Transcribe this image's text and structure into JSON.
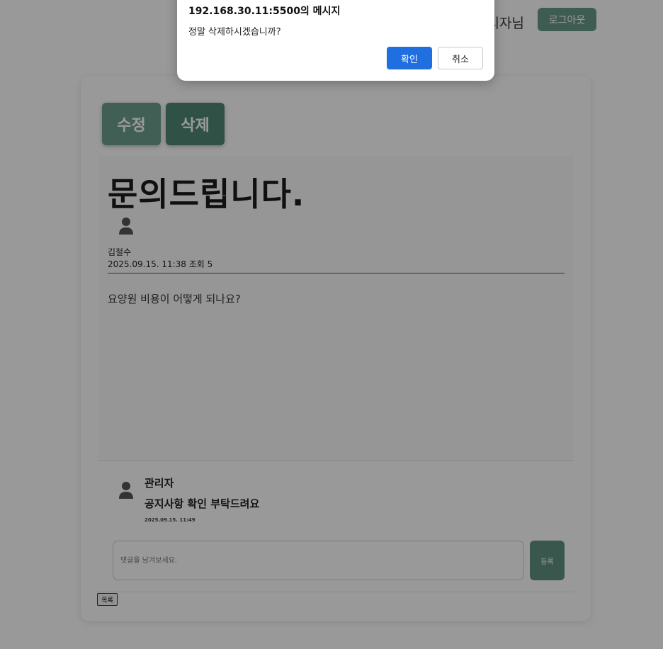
{
  "header": {
    "user_label": "관리자님",
    "logout_label": "로그아웃"
  },
  "post": {
    "edit_label": "수정",
    "delete_label": "삭제",
    "title": "문의드립니다.",
    "author": "김철수",
    "meta": "2025.09.15. 11:38 조회 5",
    "body": "요양원 비용이 어떻게 되나요?"
  },
  "comments": [
    {
      "author": "관리자",
      "text": "공지사항 확인 부탁드려요",
      "date": "2025.09.15. 11:49"
    }
  ],
  "comment_form": {
    "placeholder": "댓글을 남겨보세요.",
    "value": "",
    "submit_label": "등록"
  },
  "list_button_label": "목록",
  "dialog": {
    "title": "192.168.30.11:5500의 메시지",
    "message": "정말 삭제하시겠습니까?",
    "confirm_label": "확인",
    "cancel_label": "취소"
  },
  "colors": {
    "accent": "#5f927f",
    "dialog_primary": "#1f6fe0"
  }
}
